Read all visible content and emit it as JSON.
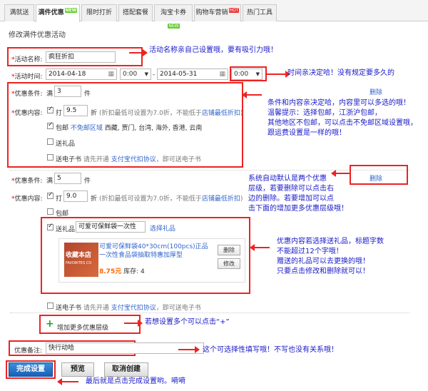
{
  "tabs": [
    {
      "label": "满就送",
      "badge": ""
    },
    {
      "label": "满件优惠",
      "badge": "NEW"
    },
    {
      "label": "限时打折",
      "badge": ""
    },
    {
      "label": "搭配套餐",
      "badge": ""
    },
    {
      "label": "淘宝卡券",
      "badge": "NEW"
    },
    {
      "label": "购物车营销",
      "badge": "HOT"
    },
    {
      "label": "热门工具",
      "badge": ""
    }
  ],
  "page_title": "修改满件优惠活动",
  "form": {
    "name_label": "活动名称:",
    "name_value": "疯狂折扣",
    "time_label": "活动时间:",
    "start_date": "2014-04-18",
    "start_time": "0:00",
    "dash": "-",
    "end_date": "2014-05-31",
    "end_time": "0:00",
    "tier1": {
      "cond_label": "优惠条件:",
      "man": "满",
      "qty": "3",
      "jian": "件",
      "content_label": "优惠内容:",
      "da": "打",
      "discount": "9.5",
      "zhe": "折",
      "hint_pre": "(折扣最低可设置为7.0折，不能低于",
      "hint_link": "店铺最低折扣",
      "hint_post": ")",
      "baoyou": "包邮",
      "exempt_link": "不免邮区域",
      "regions": "西藏, 贾门, 台湾, 海外, 香港, 云南",
      "gift": "送礼品",
      "ebook": "送电子书",
      "ebook_pre": "请先开通",
      "ebook_link": "支付宝代扣协议",
      "ebook_post": "，即可送电子书",
      "delete": "删除"
    },
    "tier2": {
      "cond_label": "优惠条件:",
      "man": "满",
      "qty": "5",
      "jian": "件",
      "content_label": "优惠内容:",
      "da": "打",
      "discount": "9.0",
      "zhe": "折",
      "hint_pre": "(折扣最低可设置为7.0折，不能低于",
      "hint_link": "店铺最低折扣",
      "hint_post": ")",
      "baoyou": "包邮",
      "gift": "送礼品",
      "gift_title": "可爱可保鲜袋一次性",
      "choose_gift": "选择礼品",
      "product_title": "可爱可保鲜袋40*30cm(100pcs)正品一次性食品袋抽取特惠加厚型",
      "price": "8.75元",
      "stock_label": "库存:",
      "stock": "4",
      "del_btn": "删除",
      "edit_btn": "修改",
      "thumb_text": "收藏本店",
      "thumb_sub": "FAVORITES CO",
      "ebook": "送电子书",
      "ebook_pre": "请先开通",
      "ebook_link": "支付宝代扣协议",
      "ebook_post": "，即可送电子书",
      "delete": "删除"
    },
    "add_tier": "增加更多优惠层级",
    "remark_label": "优惠备注:",
    "remark_value": "快行动哈",
    "btn_finish": "完成设置",
    "btn_preview": "预览",
    "btn_cancel": "取消创建"
  },
  "notes": {
    "n1": "活动名称亲自己设置哦，要有吸引力哦！",
    "n2": "时间亲决定哈！没有规定要多久的",
    "n3": "条件和内容亲决定哈，内容里可以多选的哦！\n温馨提示：选择包邮，江浙沪包邮，\n其他地区不包邮，可以点击不免邮区域设置哦，\n跟运费设置是一样的哦！",
    "n4": "系统自动默认是两个优惠\n层级，若要删除可以点击右\n边的删除。若要增加可以点\n击下面的增加更多优惠层级哦！",
    "n5": "优惠内容若选择送礼品，标题字数\n不能超过12个字哦！\n赠送的礼品可以去更换的哦！\n只要点击修改和删除就可以！",
    "n6": "若想设置多个可以点击“+”",
    "n7": "这个可选择性填写哦！不写也没有关系哦！",
    "n8": "最后就是点击完成设置哟。嗬嗬"
  },
  "colors": {
    "annotation_red": "#e22",
    "note_blue": "#1919c8",
    "link_blue": "#36c",
    "plus_green": "#2a9d2a"
  }
}
